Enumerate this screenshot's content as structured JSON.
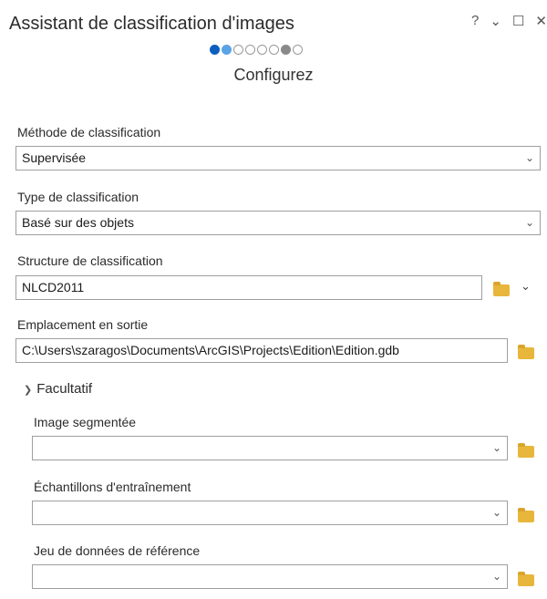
{
  "header": {
    "title": "Assistant de classification d'images",
    "step_title": "Configurez",
    "window_controls": [
      "?",
      "⌄",
      "☐",
      "✕"
    ],
    "steps": [
      {
        "state": "active"
      },
      {
        "state": "done"
      },
      {
        "state": "pending"
      },
      {
        "state": "pending"
      },
      {
        "state": "pending"
      },
      {
        "state": "pending"
      },
      {
        "state": "gray"
      },
      {
        "state": "pending"
      }
    ]
  },
  "form": {
    "method_label": "Méthode de classification",
    "method_value": "Supervisée",
    "type_label": "Type de classification",
    "type_value": "Basé sur des objets",
    "schema_label": "Structure de classification",
    "schema_value": "NLCD2011",
    "output_label": "Emplacement en sortie",
    "output_value": "C:\\Users\\szaragos\\Documents\\ArcGIS\\Projects\\Edition\\Edition.gdb"
  },
  "optional": {
    "section_label": "Facultatif",
    "segmented_label": "Image segmentée",
    "segmented_value": "",
    "training_label": "Échantillons d'entraînement",
    "training_value": "",
    "reference_label": "Jeu de données de référence",
    "reference_value": ""
  },
  "icons": {
    "folder_color": "#e8b63b",
    "accent_color": "#0b5fbd"
  }
}
